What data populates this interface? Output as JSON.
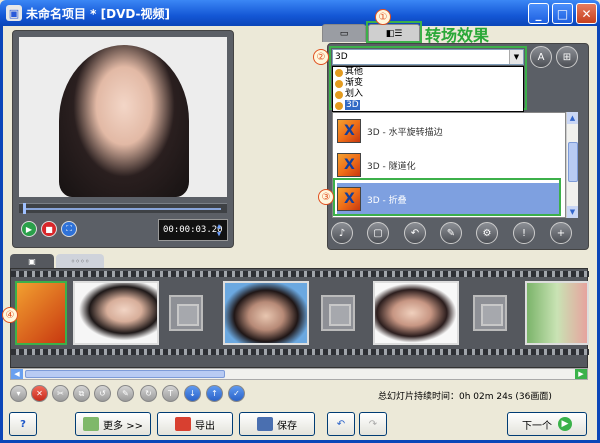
{
  "window": {
    "title": "未命名项目 * [DVD-视频]",
    "controls": {
      "minimize": "_",
      "maximize": "□",
      "close": "✕"
    }
  },
  "preview": {
    "timecode": "00:00:03.20"
  },
  "transitions": {
    "heading": "转场效果",
    "category_selected": "3D",
    "category_options": [
      "其他",
      "渐变",
      "划入",
      "3D"
    ],
    "items": [
      {
        "label": "3D - 水平旋转描边",
        "selected": false
      },
      {
        "label": "3D - 隧道化",
        "selected": false
      },
      {
        "label": "3D - 折叠",
        "selected": true
      }
    ]
  },
  "callouts": [
    "①",
    "②",
    "③",
    "④"
  ],
  "status": {
    "duration": "总幻灯片持续时间：0h 02m 24s (36画面)"
  },
  "buttons": {
    "help": "?",
    "more": "更多 >>",
    "export": "导出",
    "save": "保存",
    "next": "下一个"
  },
  "colors": {
    "titlebar": "#1457d6",
    "callout_green": "#3cb04a",
    "callout_red": "#e05020",
    "selection": "#7ea0e0"
  }
}
